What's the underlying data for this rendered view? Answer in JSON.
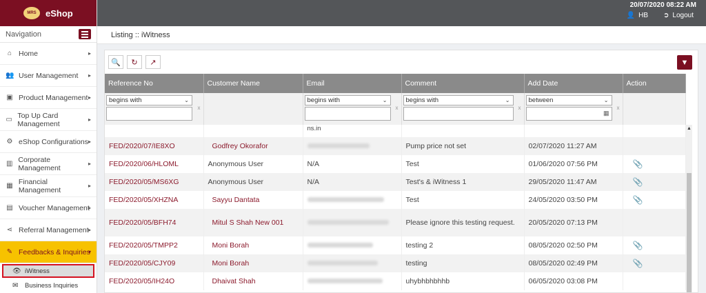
{
  "brand": {
    "logo_text": "MRS",
    "name": "eShop"
  },
  "nav": {
    "header": "Navigation",
    "items": [
      {
        "label": "Home",
        "icon": "home-icon"
      },
      {
        "label": "User Management",
        "icon": "users-icon"
      },
      {
        "label": "Product Management",
        "icon": "box-icon"
      },
      {
        "label": "Top Up Card Management",
        "icon": "card-icon"
      },
      {
        "label": "eShop Configurations",
        "icon": "gear-icon"
      },
      {
        "label": "Corporate Management",
        "icon": "chart-icon"
      },
      {
        "label": "Financial Management",
        "icon": "grid-icon"
      },
      {
        "label": "Voucher Management",
        "icon": "voucher-icon"
      },
      {
        "label": "Referral Management",
        "icon": "share-icon"
      },
      {
        "label": "Feedbacks & Inquiries",
        "icon": "edit-icon"
      }
    ],
    "sub_items": [
      {
        "label": "iWitness",
        "icon": "eye-icon"
      },
      {
        "label": "Business Inquiries",
        "icon": "mail-icon"
      }
    ]
  },
  "topbar": {
    "datetime": "20/07/2020 08:22 AM",
    "user": "HB",
    "logout": "Logout"
  },
  "breadcrumb": "Listing :: iWitness",
  "table": {
    "headers": [
      "Reference No",
      "Customer Name",
      "Email",
      "Comment",
      "Add Date",
      "Action"
    ],
    "filters": {
      "email": "begins with",
      "comment": "begins with",
      "ref": "begins with",
      "date": "between"
    },
    "partial_row_email": "ns.in",
    "rows": [
      {
        "ref": "FED/2020/07/IE8XO",
        "customer": "Godfrey Okorafor",
        "customer_link": true,
        "email": "",
        "email_blurred": true,
        "comment": "Pump price not set",
        "date": "02/07/2020 11:27 AM",
        "attachment": false
      },
      {
        "ref": "FED/2020/06/HLOML",
        "customer": "Anonymous User",
        "customer_link": false,
        "email": "N/A",
        "email_blurred": false,
        "comment": "Test",
        "date": "01/06/2020 07:56 PM",
        "attachment": true
      },
      {
        "ref": "FED/2020/05/MS6XG",
        "customer": "Anonymous User",
        "customer_link": false,
        "email": "N/A",
        "email_blurred": false,
        "comment": "Test's & iWitness 1",
        "date": "29/05/2020 11:47 AM",
        "attachment": true
      },
      {
        "ref": "FED/2020/05/XHZNA",
        "customer": "Sayyu Dantata",
        "customer_link": true,
        "email": "",
        "email_blurred": true,
        "comment": "Test",
        "date": "24/05/2020 03:50 PM",
        "attachment": true
      },
      {
        "ref": "FED/2020/05/BFH74",
        "customer": "Mitul S Shah New 001",
        "customer_link": true,
        "email": "",
        "email_blurred": true,
        "comment": "Please ignore this testing request.",
        "date": "20/05/2020 07:13 PM",
        "attachment": false
      },
      {
        "ref": "FED/2020/05/TMPP2",
        "customer": "Moni Borah",
        "customer_link": true,
        "email": "",
        "email_blurred": true,
        "comment": "testing 2",
        "date": "08/05/2020 02:50 PM",
        "attachment": true
      },
      {
        "ref": "FED/2020/05/CJY09",
        "customer": "Moni Borah",
        "customer_link": true,
        "email": "",
        "email_blurred": true,
        "comment": "testing",
        "date": "08/05/2020 02:49 PM",
        "attachment": true
      },
      {
        "ref": "FED/2020/05/IH24O",
        "customer": "Dhaivat Shah",
        "customer_link": true,
        "email": "",
        "email_blurred": true,
        "comment": "uhybhbhbhhb",
        "date": "06/05/2020 03:08 PM",
        "attachment": false
      }
    ]
  }
}
